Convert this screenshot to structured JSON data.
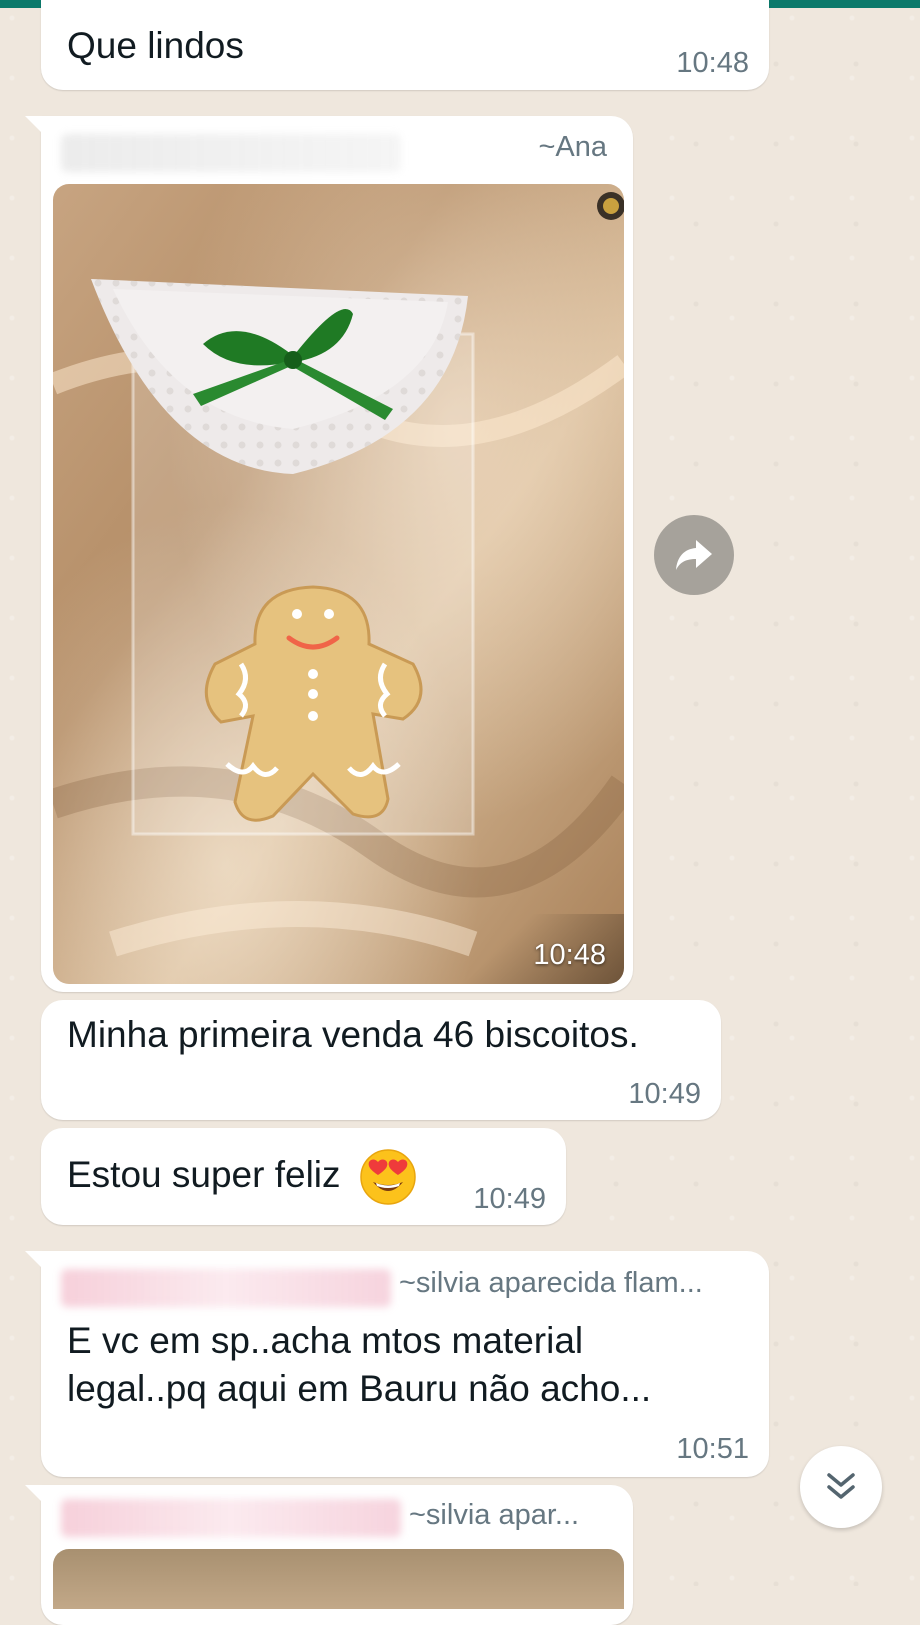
{
  "messages": [
    {
      "text": "Que lindos",
      "time": "10:48"
    },
    {
      "sender": "~Ana",
      "time": "10:48"
    },
    {
      "text": "Minha primeira venda 46 biscoitos.",
      "time": "10:49"
    },
    {
      "text": "Estou super feliz",
      "emoji": "heart-eyes-emoji",
      "time": "10:49"
    },
    {
      "sender": "~silvia aparecida flam...",
      "text_line1": "E vc em sp..acha mtos material",
      "text_line2": "legal..pq aqui em Bauru não acho...",
      "time": "10:51"
    },
    {
      "sender": "~silvia apar..."
    }
  ],
  "icons": {
    "forward": "forward-arrow-icon",
    "scroll_down": "double-chevron-down-icon"
  },
  "colors": {
    "wallpaper": "#efe7dd",
    "bubble": "#ffffff",
    "header_accent": "#0b7a6b",
    "time_text": "#667781",
    "bow_green": "#1f7a24"
  }
}
